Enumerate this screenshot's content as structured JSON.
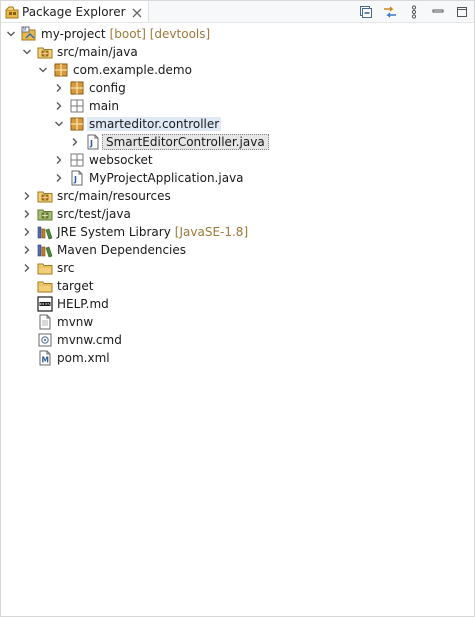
{
  "view": {
    "title": "Package Explorer",
    "toolbar": [
      "collapse-all-icon",
      "link-with-editor-icon",
      "view-menu-icon",
      "minimize-icon",
      "maximize-icon"
    ]
  },
  "tree": {
    "project": {
      "label": "my-project",
      "decoration": "[boot] [devtools]"
    },
    "src_main_java": "src/main/java",
    "pkg_demo": "com.example.demo",
    "pkg_config": "config",
    "pkg_main": "main",
    "pkg_controller": "smarteditor.controller",
    "file_controller": "SmartEditorController.java",
    "pkg_websocket": "websocket",
    "file_app": "MyProjectApplication.java",
    "src_main_resources": "src/main/resources",
    "src_test_java": "src/test/java",
    "jre": {
      "label": "JRE System Library",
      "decoration": "[JavaSE-1.8]"
    },
    "maven": "Maven Dependencies",
    "src": "src",
    "target": "target",
    "help": "HELP.md",
    "mvnw": "mvnw",
    "mvnw_cmd": "mvnw.cmd",
    "pom": "pom.xml"
  },
  "colors": {
    "accent": "#3c78c8",
    "folder": "#e8b84a",
    "package": "#c0832a",
    "decoration": "#9a7a3a"
  }
}
